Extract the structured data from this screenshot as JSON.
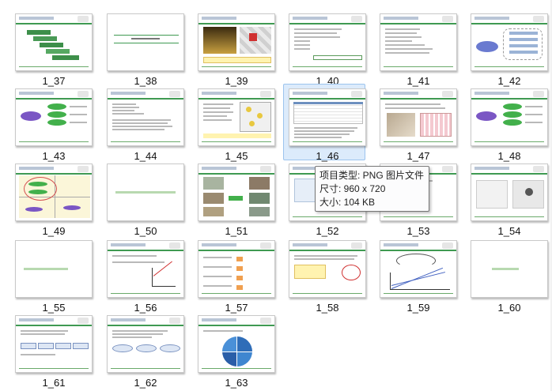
{
  "thumbnails": [
    {
      "label": "1_37"
    },
    {
      "label": "1_38"
    },
    {
      "label": "1_39"
    },
    {
      "label": "1_40"
    },
    {
      "label": "1_41"
    },
    {
      "label": "1_42"
    },
    {
      "label": "1_43"
    },
    {
      "label": "1_44"
    },
    {
      "label": "1_45"
    },
    {
      "label": "1_46"
    },
    {
      "label": "1_47"
    },
    {
      "label": "1_48"
    },
    {
      "label": "1_49"
    },
    {
      "label": "1_50"
    },
    {
      "label": "1_51"
    },
    {
      "label": "1_52"
    },
    {
      "label": "1_53"
    },
    {
      "label": "1_54"
    },
    {
      "label": "1_55"
    },
    {
      "label": "1_56"
    },
    {
      "label": "1_57"
    },
    {
      "label": "1_58"
    },
    {
      "label": "1_59"
    },
    {
      "label": "1_60"
    },
    {
      "label": "1_61"
    },
    {
      "label": "1_62"
    },
    {
      "label": "1_63"
    }
  ],
  "selected_label": "1_46",
  "tooltip": {
    "type": "项目类型: PNG 图片文件",
    "dimensions": "尺寸: 960 x 720",
    "size": "大小: 104 KB"
  },
  "colors": {
    "selection_bg": "#dcebfb",
    "selection_border": "#9cc4ee",
    "slide_accent_green": "#3f9a52",
    "slide_bubble_purple": "#7a56c4",
    "slide_bubble_green": "#42b04b"
  },
  "icons": {
    "thumbnail": "image-file-icon"
  }
}
